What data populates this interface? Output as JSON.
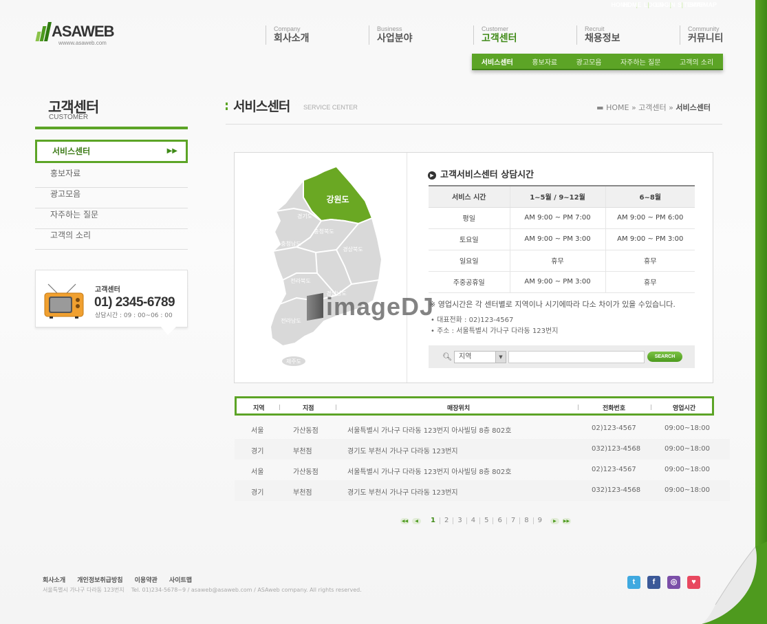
{
  "top_links": [
    "HOME",
    "LOGIN",
    "SITEMAP"
  ],
  "logo": {
    "name": "ASAWEB",
    "url_text": "wwww.asaweb.com"
  },
  "gnb": [
    {
      "en": "Company",
      "ko": "회사소개"
    },
    {
      "en": "Business",
      "ko": "사업분야"
    },
    {
      "en": "Customer",
      "ko": "고객센터"
    },
    {
      "en": "Recruit",
      "ko": "채용정보"
    },
    {
      "en": "Community",
      "ko": "커뮤니티"
    }
  ],
  "subnav": [
    "서비스센터",
    "홍보자료",
    "광고모음",
    "자주하는 질문",
    "고객의 소리"
  ],
  "lnb": {
    "title": "고객센터",
    "title_en": "CUSTOMER",
    "items": [
      "서비스센터",
      "홍보자료",
      "광고모음",
      "자주하는 질문",
      "고객의 소리"
    ]
  },
  "cs_box": {
    "label": "고객센터",
    "phone": "01) 2345-6789",
    "hours": "상담시간 : 09 : 00~06 : 00"
  },
  "content": {
    "title": "서비스센터",
    "title_en": "SERVICE CENTER",
    "breadcrumb": {
      "home": "HOME",
      "sep": "»",
      "mid": "고객센터",
      "current": "서비스센터"
    }
  },
  "map": {
    "highlight": "강원도",
    "regions": [
      "경기도",
      "충청북도",
      "충청남도",
      "경상북도",
      "전라북도",
      "경상남도",
      "전라남도",
      "제주도"
    ]
  },
  "hours": {
    "title": "고객서비스센터 상담시간",
    "headers": [
      "서비스 시간",
      "1~5월 / 9~12월",
      "6~8월"
    ],
    "rows": [
      [
        "평일",
        "AM 9:00 ~ PM 7:00",
        "AM 9:00 ~ PM 6:00"
      ],
      [
        "토요일",
        "AM 9:00 ~ PM 3:00",
        "AM 9:00 ~ PM 3:00"
      ],
      [
        "일요일",
        "휴무",
        "휴무"
      ],
      [
        "주중공휴일",
        "AM 9:00 ~ PM 3:00",
        "휴무"
      ]
    ],
    "note": "※ 영업시간은 각 센터별로 지역이나 시기에따라 다소 차이가 있을 수있습니다.",
    "phone": "• 대표전화 : 02)123-4567",
    "address": "• 주소 : 서울특별시 가나구 다라동 123번지"
  },
  "search": {
    "select_value": "지역",
    "button": "SEARCH"
  },
  "watermark": "imageDJ",
  "table": {
    "headers": [
      "지역",
      "지점",
      "매장위치",
      "전화번호",
      "영업시간"
    ],
    "rows": [
      [
        "서울",
        "가산동점",
        "서울특별시 가나구 다라동 123번지 아사빌딩 8층 802호",
        "02)123-4567",
        "09:00~18:00"
      ],
      [
        "경기",
        "부천점",
        "경기도 부천시 가나구 다라동 123번지",
        "032)123-4568",
        "09:00~18:00"
      ],
      [
        "서울",
        "가산동점",
        "서울특별시 가나구 다라동 123번지 아사빌딩 8층 802호",
        "02)123-4567",
        "09:00~18:00"
      ],
      [
        "경기",
        "부천점",
        "경기도 부천시 가나구 다라동 123번지",
        "032)123-4568",
        "09:00~18:00"
      ]
    ]
  },
  "pagination": {
    "pages": [
      "1",
      "2",
      "3",
      "4",
      "5",
      "6",
      "7",
      "8",
      "9"
    ],
    "current": "1"
  },
  "footer": {
    "links": [
      "회사소개",
      "개인정보취급방침",
      "이용약관",
      "사이트맵"
    ],
    "copy": "서울특별시 가나구 다라동 123번지    Tel. 01)234-5678~9 / asaweb@asaweb.com / ASAweb company. All rights reserved."
  },
  "social_icons": [
    "twitter-icon",
    "facebook-icon",
    "me2day-icon",
    "blog-icon"
  ],
  "colors": {
    "accent": "#5ca426",
    "accent_dark": "#3f8a17",
    "map_highlight": "#6aa823"
  }
}
